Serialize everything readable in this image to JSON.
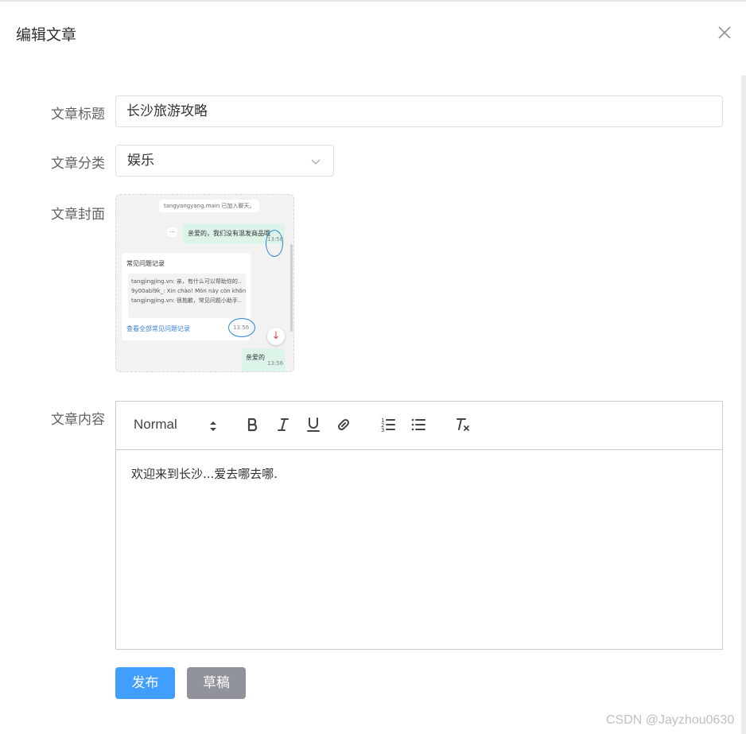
{
  "dialog": {
    "title": "编辑文章",
    "close_icon": "close-icon"
  },
  "form": {
    "title_label": "文章标题",
    "title_value": "长沙旅游攻略",
    "category_label": "文章分类",
    "category_value": "娱乐",
    "cover_label": "文章封面",
    "content_label": "文章内容"
  },
  "cover_image": {
    "system_msg": "tangyangyang.main 已加入聊天。",
    "dots": "···",
    "green_msg_1": "亲爱的，我们没有混发商品哦",
    "time_1": "13:56",
    "card_title": "常见问题记录",
    "card_lines": [
      "tangjingjing.vn: 亲，有什么可以帮助你的..",
      "9y00abl9k_: Xin chào! Món này còn khôn..",
      "tangjingjing.vn: 很抱歉，常见问题小助手.."
    ],
    "card_link": "查看全部常见问题记录",
    "time_2": "13:56",
    "down_arrow": "↓",
    "green_msg_2": "亲爱的",
    "time_3": "13:56"
  },
  "editor": {
    "header_select": "Normal",
    "toolbar_icons": [
      "bold-icon",
      "italic-icon",
      "underline-icon",
      "link-icon",
      "ordered-list-icon",
      "bullet-list-icon",
      "clear-format-icon"
    ],
    "content": "欢迎来到长沙...爱去哪去哪."
  },
  "buttons": {
    "publish": "发布",
    "draft": "草稿"
  },
  "colors": {
    "primary": "#409eff",
    "info": "#909399",
    "circle_annotation": "#2f86d6"
  },
  "watermark": "CSDN @Jayzhou0630"
}
